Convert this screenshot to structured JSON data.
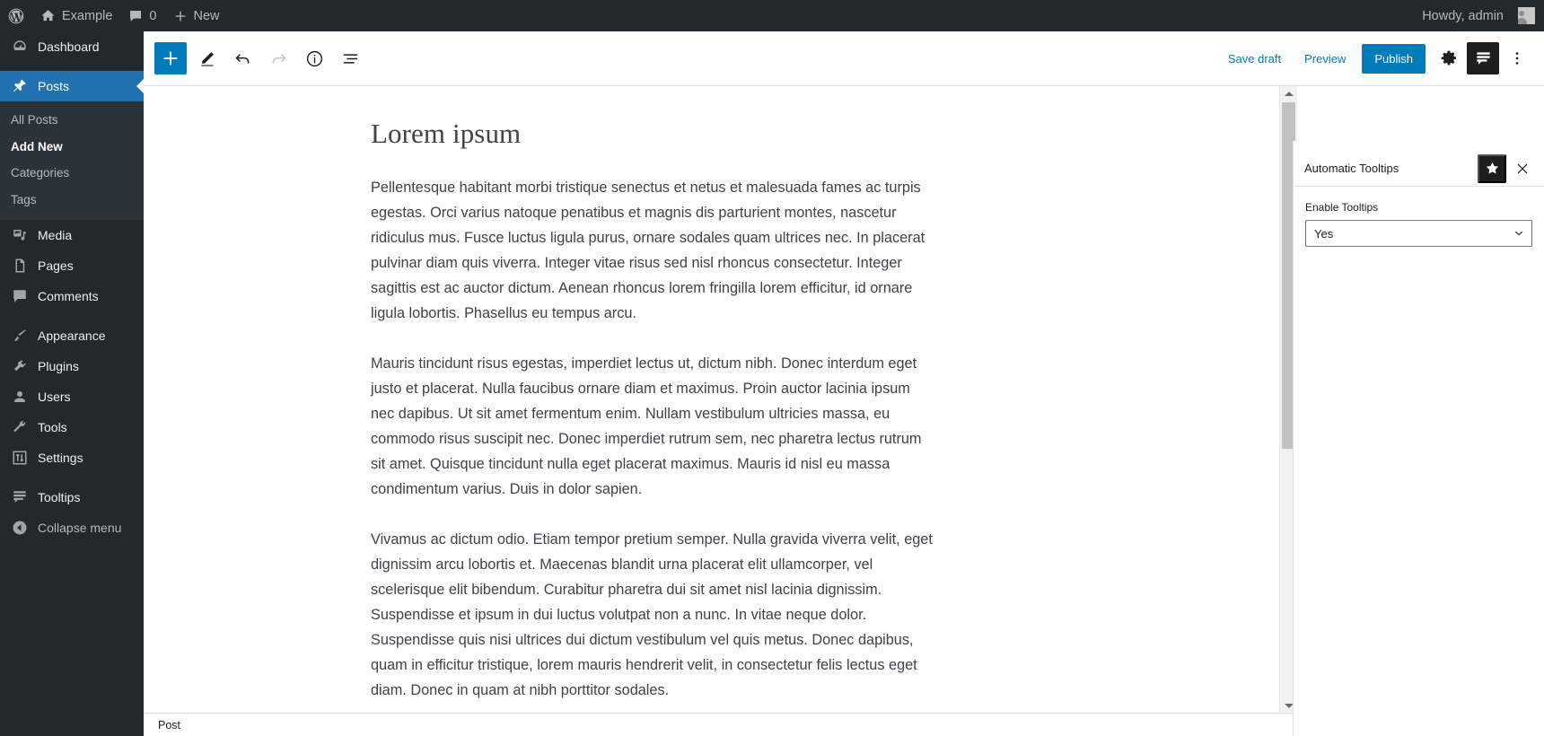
{
  "admin_bar": {
    "logo_icon": "wordpress-logo-icon",
    "site_icon": "home-icon",
    "site_name": "Example",
    "comments_icon": "comment-bubble-icon",
    "comments_count": "0",
    "new_icon": "plus-icon",
    "new_label": "New",
    "howdy": "Howdy, admin",
    "avatar_icon": "user-avatar-icon"
  },
  "admin_menu": {
    "items": [
      {
        "label": "Dashboard",
        "icon": "dashboard-gauge-icon",
        "current": false
      },
      {
        "label": "Posts",
        "icon": "pushpin-icon",
        "current": true
      },
      {
        "label": "Media",
        "icon": "media-photo-music-icon",
        "current": false
      },
      {
        "label": "Pages",
        "icon": "pages-document-icon",
        "current": false
      },
      {
        "label": "Comments",
        "icon": "comment-bubble-icon",
        "current": false
      },
      {
        "label": "Appearance",
        "icon": "paintbrush-icon",
        "current": false
      },
      {
        "label": "Plugins",
        "icon": "plug-icon",
        "current": false
      },
      {
        "label": "Users",
        "icon": "user-icon",
        "current": false
      },
      {
        "label": "Tools",
        "icon": "wrench-icon",
        "current": false
      },
      {
        "label": "Settings",
        "icon": "sliders-icon",
        "current": false
      },
      {
        "label": "Tooltips",
        "icon": "tooltips-speech-icon",
        "current": false
      },
      {
        "label": "Collapse menu",
        "icon": "collapse-arrow-icon",
        "current": false
      }
    ],
    "posts_submenu": [
      {
        "label": "All Posts",
        "current": false
      },
      {
        "label": "Add New",
        "current": true
      },
      {
        "label": "Categories",
        "current": false
      },
      {
        "label": "Tags",
        "current": false
      }
    ]
  },
  "editor_toolbar": {
    "add_block_icon": "plus-icon",
    "tools_icon": "pencil-icon",
    "undo_icon": "undo-arrow-icon",
    "redo_icon": "redo-arrow-icon",
    "details_icon": "info-circle-icon",
    "list_view_icon": "list-view-icon",
    "save_draft_label": "Save draft",
    "preview_label": "Preview",
    "publish_label": "Publish",
    "settings_icon": "gear-icon",
    "tooltips_panel_icon": "tooltips-speech-icon",
    "options_icon": "three-dots-vertical-icon"
  },
  "post": {
    "title": "Lorem ipsum",
    "paragraphs": [
      "Pellentesque habitant morbi tristique senectus et netus et malesuada fames ac turpis egestas. Orci varius natoque penatibus et magnis dis parturient montes, nascetur ridiculus mus. Fusce luctus ligula purus, ornare sodales quam ultrices nec. In placerat pulvinar diam quis viverra. Integer vitae risus sed nisl rhoncus consectetur. Integer sagittis est ac auctor dictum. Aenean rhoncus lorem fringilla lorem efficitur, id ornare ligula lobortis. Phasellus eu tempus arcu.",
      "Mauris tincidunt risus egestas, imperdiet lectus ut, dictum nibh. Donec interdum eget justo et placerat. Nulla faucibus ornare diam et maximus. Proin auctor lacinia ipsum nec dapibus. Ut sit amet fermentum enim. Nullam vestibulum ultricies massa, eu commodo risus suscipit nec. Donec imperdiet rutrum sem, nec pharetra lectus rutrum sit amet. Quisque tincidunt nulla eget placerat maximus. Mauris id nisl eu massa condimentum varius. Duis in dolor sapien.",
      "Vivamus ac dictum odio. Etiam tempor pretium semper. Nulla gravida viverra velit, eget dignissim arcu lobortis et. Maecenas blandit urna placerat elit ullamcorper, vel scelerisque elit bibendum. Curabitur pharetra dui sit amet nisl lacinia dignissim. Suspendisse et ipsum in dui luctus volutpat non a nunc. In vitae neque dolor. Suspendisse quis nisi ultrices dui dictum vestibulum vel quis metus. Donec dapibus, quam in efficitur tristique, lorem mauris hendrerit velit, in consectetur felis lectus eget diam. Donec in quam at nibh porttitor sodales."
    ]
  },
  "footer": {
    "breadcrumb": "Post"
  },
  "settings_sidebar": {
    "title": "Automatic Tooltips",
    "pin_icon": "star-filled-icon",
    "close_icon": "close-x-icon",
    "enable_tooltips_label": "Enable Tooltips",
    "enable_tooltips_value": "Yes"
  },
  "scrollbar": {
    "up_icon": "triangle-up-icon",
    "down_icon": "triangle-down-icon"
  },
  "colors": {
    "admin_dark": "#23282d",
    "admin_submenu": "#2c3338",
    "accent_blue": "#2271b1",
    "editor_blue": "#007cba",
    "text_dark": "#1e1e1e",
    "body_text": "#3c434a"
  }
}
